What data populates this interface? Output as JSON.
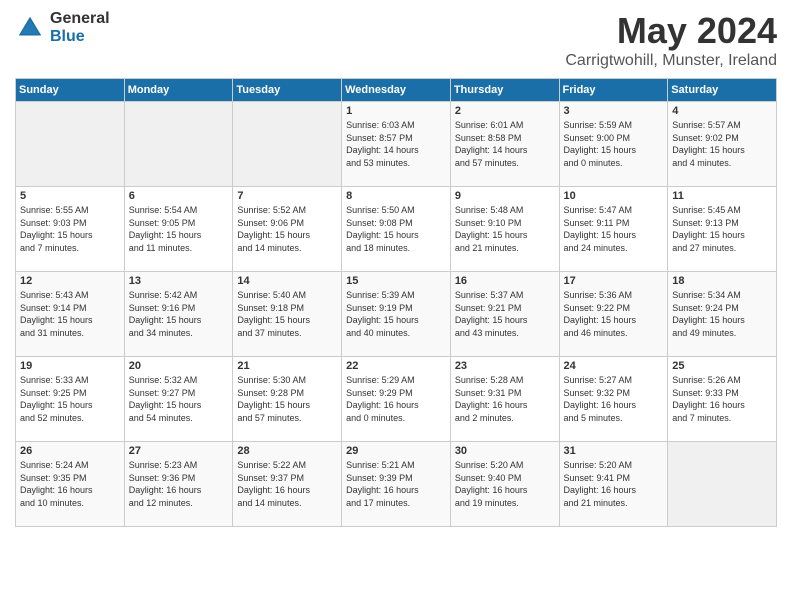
{
  "logo": {
    "general": "General",
    "blue": "Blue"
  },
  "header": {
    "month": "May 2024",
    "location": "Carrigtwohill, Munster, Ireland"
  },
  "days_of_week": [
    "Sunday",
    "Monday",
    "Tuesday",
    "Wednesday",
    "Thursday",
    "Friday",
    "Saturday"
  ],
  "weeks": [
    [
      {
        "day": "",
        "info": ""
      },
      {
        "day": "",
        "info": ""
      },
      {
        "day": "",
        "info": ""
      },
      {
        "day": "1",
        "info": "Sunrise: 6:03 AM\nSunset: 8:57 PM\nDaylight: 14 hours\nand 53 minutes."
      },
      {
        "day": "2",
        "info": "Sunrise: 6:01 AM\nSunset: 8:58 PM\nDaylight: 14 hours\nand 57 minutes."
      },
      {
        "day": "3",
        "info": "Sunrise: 5:59 AM\nSunset: 9:00 PM\nDaylight: 15 hours\nand 0 minutes."
      },
      {
        "day": "4",
        "info": "Sunrise: 5:57 AM\nSunset: 9:02 PM\nDaylight: 15 hours\nand 4 minutes."
      }
    ],
    [
      {
        "day": "5",
        "info": "Sunrise: 5:55 AM\nSunset: 9:03 PM\nDaylight: 15 hours\nand 7 minutes."
      },
      {
        "day": "6",
        "info": "Sunrise: 5:54 AM\nSunset: 9:05 PM\nDaylight: 15 hours\nand 11 minutes."
      },
      {
        "day": "7",
        "info": "Sunrise: 5:52 AM\nSunset: 9:06 PM\nDaylight: 15 hours\nand 14 minutes."
      },
      {
        "day": "8",
        "info": "Sunrise: 5:50 AM\nSunset: 9:08 PM\nDaylight: 15 hours\nand 18 minutes."
      },
      {
        "day": "9",
        "info": "Sunrise: 5:48 AM\nSunset: 9:10 PM\nDaylight: 15 hours\nand 21 minutes."
      },
      {
        "day": "10",
        "info": "Sunrise: 5:47 AM\nSunset: 9:11 PM\nDaylight: 15 hours\nand 24 minutes."
      },
      {
        "day": "11",
        "info": "Sunrise: 5:45 AM\nSunset: 9:13 PM\nDaylight: 15 hours\nand 27 minutes."
      }
    ],
    [
      {
        "day": "12",
        "info": "Sunrise: 5:43 AM\nSunset: 9:14 PM\nDaylight: 15 hours\nand 31 minutes."
      },
      {
        "day": "13",
        "info": "Sunrise: 5:42 AM\nSunset: 9:16 PM\nDaylight: 15 hours\nand 34 minutes."
      },
      {
        "day": "14",
        "info": "Sunrise: 5:40 AM\nSunset: 9:18 PM\nDaylight: 15 hours\nand 37 minutes."
      },
      {
        "day": "15",
        "info": "Sunrise: 5:39 AM\nSunset: 9:19 PM\nDaylight: 15 hours\nand 40 minutes."
      },
      {
        "day": "16",
        "info": "Sunrise: 5:37 AM\nSunset: 9:21 PM\nDaylight: 15 hours\nand 43 minutes."
      },
      {
        "day": "17",
        "info": "Sunrise: 5:36 AM\nSunset: 9:22 PM\nDaylight: 15 hours\nand 46 minutes."
      },
      {
        "day": "18",
        "info": "Sunrise: 5:34 AM\nSunset: 9:24 PM\nDaylight: 15 hours\nand 49 minutes."
      }
    ],
    [
      {
        "day": "19",
        "info": "Sunrise: 5:33 AM\nSunset: 9:25 PM\nDaylight: 15 hours\nand 52 minutes."
      },
      {
        "day": "20",
        "info": "Sunrise: 5:32 AM\nSunset: 9:27 PM\nDaylight: 15 hours\nand 54 minutes."
      },
      {
        "day": "21",
        "info": "Sunrise: 5:30 AM\nSunset: 9:28 PM\nDaylight: 15 hours\nand 57 minutes."
      },
      {
        "day": "22",
        "info": "Sunrise: 5:29 AM\nSunset: 9:29 PM\nDaylight: 16 hours\nand 0 minutes."
      },
      {
        "day": "23",
        "info": "Sunrise: 5:28 AM\nSunset: 9:31 PM\nDaylight: 16 hours\nand 2 minutes."
      },
      {
        "day": "24",
        "info": "Sunrise: 5:27 AM\nSunset: 9:32 PM\nDaylight: 16 hours\nand 5 minutes."
      },
      {
        "day": "25",
        "info": "Sunrise: 5:26 AM\nSunset: 9:33 PM\nDaylight: 16 hours\nand 7 minutes."
      }
    ],
    [
      {
        "day": "26",
        "info": "Sunrise: 5:24 AM\nSunset: 9:35 PM\nDaylight: 16 hours\nand 10 minutes."
      },
      {
        "day": "27",
        "info": "Sunrise: 5:23 AM\nSunset: 9:36 PM\nDaylight: 16 hours\nand 12 minutes."
      },
      {
        "day": "28",
        "info": "Sunrise: 5:22 AM\nSunset: 9:37 PM\nDaylight: 16 hours\nand 14 minutes."
      },
      {
        "day": "29",
        "info": "Sunrise: 5:21 AM\nSunset: 9:39 PM\nDaylight: 16 hours\nand 17 minutes."
      },
      {
        "day": "30",
        "info": "Sunrise: 5:20 AM\nSunset: 9:40 PM\nDaylight: 16 hours\nand 19 minutes."
      },
      {
        "day": "31",
        "info": "Sunrise: 5:20 AM\nSunset: 9:41 PM\nDaylight: 16 hours\nand 21 minutes."
      },
      {
        "day": "",
        "info": ""
      }
    ]
  ]
}
